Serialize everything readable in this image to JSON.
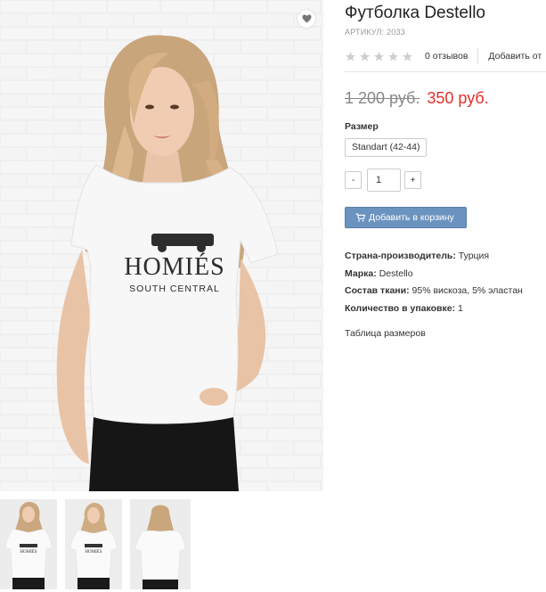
{
  "product": {
    "title": "Футболка Destello",
    "sku": "АРТИКУЛ: 2033",
    "rating_stars": 0,
    "reviews": "0 отзывов",
    "add_review": "Добавить от",
    "old_price": "1 200 руб.",
    "new_price": "350 руб.",
    "size_label": "Размер",
    "size_option": "Standart (42-44)",
    "qty_minus": "-",
    "qty_value": "1",
    "qty_plus": "+",
    "cart_button": "Добавить в корзину",
    "props": [
      {
        "key": "Страна-производитель:",
        "value": "Турция"
      },
      {
        "key": "Марка:",
        "value": "Destello"
      },
      {
        "key": "Состав ткани:",
        "value": "95% вискоза, 5% эластан"
      },
      {
        "key": "Количество в упаковке:",
        "value": "1"
      }
    ],
    "size_table_link": "Таблица размеров"
  },
  "image": {
    "shirt_print_main": "HOMIÉS",
    "shirt_print_sub": "SOUTH CENTRAL"
  },
  "icons": {
    "wishlist": "heart-icon",
    "cart": "cart-icon",
    "star": "star-icon"
  },
  "colors": {
    "price_new": "#e52d2d",
    "cart_button": "#6b93c0",
    "star_empty": "#cfcfcf"
  }
}
